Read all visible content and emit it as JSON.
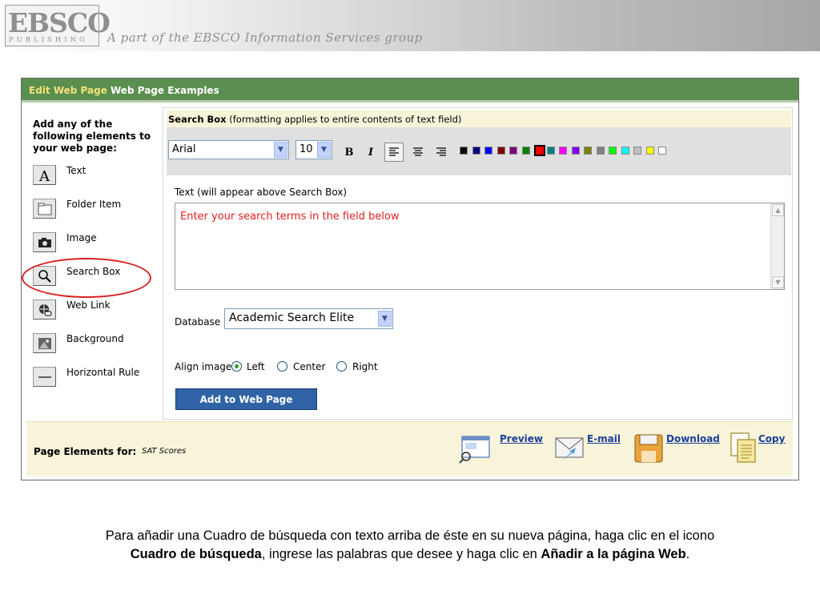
{
  "brand": {
    "logo_main": "EBSCO",
    "logo_sub": "PUBLISHING",
    "tagline": "A part of the EBSCO Information Services group"
  },
  "nav": {
    "edit_web_page": "Edit Web Page",
    "web_page_examples": "Web Page Examples"
  },
  "left_panel": {
    "heading": "Add any of the following elements to your web page:",
    "items": [
      {
        "label": "Text",
        "icon": "text-icon"
      },
      {
        "label": "Folder Item",
        "icon": "folder-icon"
      },
      {
        "label": "Image",
        "icon": "camera-icon"
      },
      {
        "label": "Search Box",
        "icon": "magnifier-icon"
      },
      {
        "label": "Web Link",
        "icon": "web-link-icon"
      },
      {
        "label": "Background",
        "icon": "background-icon"
      },
      {
        "label": "Horizontal Rule",
        "icon": "horizontal-rule-icon"
      }
    ]
  },
  "search_box": {
    "title_bold": "Search Box",
    "title_note": " (formatting applies to entire contents of text field)",
    "font_family": "Arial",
    "font_size": "10",
    "bold_label": "B",
    "italic_label": "I",
    "colors": [
      "#000000",
      "#000080",
      "#0000ff",
      "#800000",
      "#800080",
      "#008000",
      "#ff0000",
      "#008080",
      "#ff00ff",
      "#8000ff",
      "#808000",
      "#808080",
      "#00ff00",
      "#00ffff",
      "#c0c0c0",
      "#ffff00",
      "#ffffff"
    ],
    "selected_color": "#ff0000",
    "text_label": "Text (will appear above Search Box)",
    "text_value": "Enter your search terms in the field below",
    "database_label": "Database",
    "database_value": "Academic Search Elite",
    "align_label": "Align image:",
    "align_options": [
      "Left",
      "Center",
      "Right"
    ],
    "align_selected": "Left",
    "add_button": "Add to Web Page"
  },
  "footer": {
    "page_elements_label": "Page Elements for:",
    "page_name": "SAT Scores",
    "actions": [
      {
        "label": "Preview",
        "icon": "preview-icon"
      },
      {
        "label": "E-mail",
        "icon": "email-icon"
      },
      {
        "label": "Download",
        "icon": "download-icon"
      },
      {
        "label": "Copy",
        "icon": "copy-icon"
      }
    ]
  },
  "caption": {
    "part1": "Para añadir una Cuadro de búsqueda con texto arriba de éste en su nueva página, haga clic en el icono",
    "bold1": "Cuadro de búsqueda",
    "part2": ", ingrese las palabras que desee y haga clic en ",
    "bold2": "Añadir a la página Web",
    "part3": "."
  }
}
